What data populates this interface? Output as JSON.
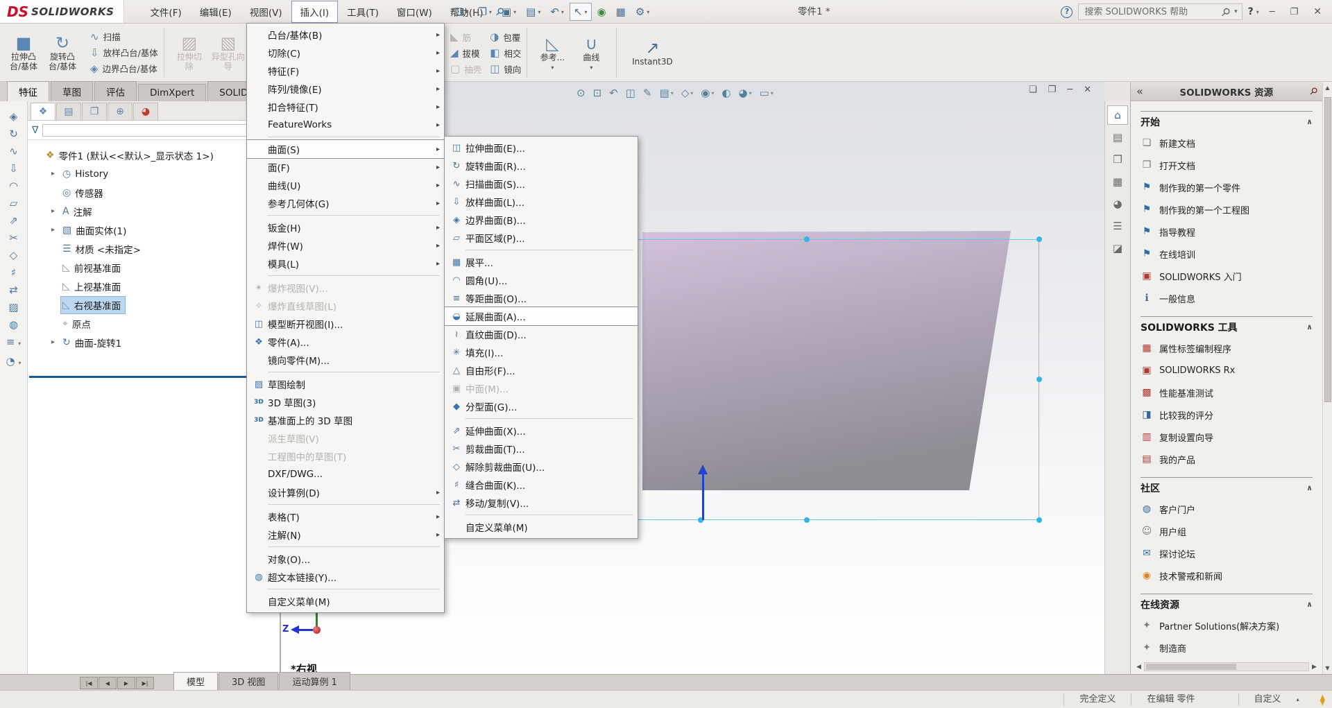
{
  "titlebar": {
    "logo_ds": "DS",
    "logo_text": "SOLIDWORKS",
    "doc_title": "零件1 *",
    "pin_icon": "⚲",
    "search": {
      "placeholder": "搜索 SOLIDWORKS 帮助",
      "help_badge": "?",
      "magnifier": "⚲",
      "caret": "▾"
    },
    "window_icons": {
      "help": "?",
      "help_caret": "▾",
      "minimize": "─",
      "restore": "❐",
      "close": "✕"
    },
    "menus": [
      {
        "label": "文件(F)"
      },
      {
        "label": "编辑(E)"
      },
      {
        "label": "视图(V)"
      },
      {
        "label": "插入(I)",
        "classes": "active"
      },
      {
        "label": "工具(T)"
      },
      {
        "label": "窗口(W)"
      },
      {
        "label": "帮助(H)"
      }
    ],
    "quickbar": [
      {
        "glyph": "❏",
        "icon_name": "new-document-icon",
        "classes": "caret"
      },
      {
        "glyph": "❐",
        "icon_name": "open-icon",
        "classes": "caret"
      },
      {
        "glyph": "▣",
        "icon_name": "save-icon",
        "classes": "caret"
      },
      {
        "glyph": "▤",
        "icon_name": "print-icon",
        "classes": "caret"
      },
      {
        "glyph": "↶",
        "icon_name": "undo-icon",
        "classes": "caret"
      },
      {
        "glyph": "↖",
        "icon_name": "select-arrow-icon",
        "classes": "caret pressed"
      },
      {
        "glyph": "◉",
        "icon_name": "rebuild-icon",
        "classes": "ic-green"
      },
      {
        "glyph": "▦",
        "icon_name": "file-properties-icon",
        "classes": ""
      },
      {
        "glyph": "⚙",
        "icon_name": "options-gear-icon",
        "classes": "caret"
      }
    ]
  },
  "ribbon": {
    "left_big": [
      {
        "label1": "拉伸凸",
        "label2": "台/基体",
        "icon": "■",
        "icon_name": "extruded-boss-icon",
        "classes": ""
      },
      {
        "label1": "旋转凸",
        "label2": "台/基体",
        "icon": "↻",
        "icon_name": "revolved-boss-icon",
        "classes": ""
      }
    ],
    "left_small": [
      {
        "label": "扫描",
        "icon": "∿",
        "icon_name": "swept-boss-icon",
        "classes": ""
      },
      {
        "label": "放样凸台/基体",
        "icon": "⇩",
        "icon_name": "lofted-boss-icon",
        "classes": ""
      },
      {
        "label": "边界凸台/基体",
        "icon": "◈",
        "icon_name": "boundary-boss-icon",
        "classes": ""
      }
    ],
    "left_big2": [
      {
        "label1": "拉伸切",
        "label2": "除",
        "icon": "▨",
        "icon_name": "extruded-cut-icon",
        "classes": "disabled"
      },
      {
        "label1": "异型孔向",
        "label2": "导",
        "icon": "▧",
        "icon_name": "hole-wizard-icon",
        "classes": "disabled"
      }
    ],
    "right_col1": [
      {
        "label": "筋",
        "icon": "◣",
        "icon_name": "rib-icon",
        "classes": "disabled"
      },
      {
        "label": "拔模",
        "icon": "◢",
        "icon_name": "draft-icon",
        "classes": ""
      },
      {
        "label": "抽壳",
        "icon": "▢",
        "icon_name": "shell-icon",
        "classes": "disabled"
      }
    ],
    "right_col2": [
      {
        "label": "包覆",
        "icon": "◑",
        "icon_name": "wrap-icon",
        "classes": ""
      },
      {
        "label": "相交",
        "icon": "◧",
        "icon_name": "intersect-icon",
        "classes": ""
      },
      {
        "label": "镜向",
        "icon": "◫",
        "icon_name": "mirror-icon",
        "classes": ""
      }
    ],
    "right_big": [
      {
        "label": "参考...",
        "icon": "◺",
        "icon_name": "reference-geometry-icon",
        "classes": "caret"
      },
      {
        "label": "曲线",
        "icon": "∪",
        "icon_name": "curves-icon",
        "classes": "caret"
      }
    ],
    "instant3d": {
      "label": "Instant3D",
      "icon": "↗",
      "icon_name": "instant3d-icon"
    },
    "tabs": [
      {
        "label": "特征",
        "classes": "active"
      },
      {
        "label": "草图",
        "classes": ""
      },
      {
        "label": "评估",
        "classes": ""
      },
      {
        "label": "DimXpert",
        "classes": ""
      },
      {
        "label": "SOLIDWORKS 插件",
        "classes": ""
      }
    ]
  },
  "left_strip": [
    {
      "glyph": "◈",
      "icon_name": "left-tool-boundary-surface-icon",
      "classes": ""
    },
    {
      "glyph": "↻",
      "icon_name": "left-tool-revolve-icon",
      "classes": ""
    },
    {
      "glyph": "∿",
      "icon_name": "left-tool-sweep-icon",
      "classes": ""
    },
    {
      "glyph": "⇩",
      "icon_name": "left-tool-loft-icon",
      "classes": ""
    },
    {
      "glyph": "◠",
      "icon_name": "left-tool-fillet-icon",
      "classes": ""
    },
    {
      "glyph": "▱",
      "icon_name": "left-tool-planar-icon",
      "classes": ""
    },
    {
      "glyph": "⇗",
      "icon_name": "left-tool-extend-icon",
      "classes": ""
    },
    {
      "glyph": "✂",
      "icon_name": "left-tool-trim-icon",
      "classes": ""
    },
    {
      "glyph": "◇",
      "icon_name": "left-tool-untrim-icon",
      "classes": ""
    },
    {
      "glyph": "♯",
      "icon_name": "left-tool-knit-icon",
      "classes": ""
    },
    {
      "glyph": "⇄",
      "icon_name": "left-tool-move-copy-icon",
      "classes": ""
    },
    {
      "glyph": "▨",
      "icon_name": "left-tool-sketch-icon",
      "classes": ""
    },
    {
      "glyph": "◍",
      "icon_name": "left-tool-fill-icon",
      "classes": ""
    },
    {
      "glyph": "≡",
      "icon_name": "left-tool-offset-icon",
      "classes": "caret"
    },
    {
      "glyph": "◔",
      "icon_name": "left-tool-freeform-icon",
      "classes": "caret"
    }
  ],
  "left_panel": {
    "tabs": [
      {
        "glyph": "❖",
        "icon_name": "featuremanager-tab-icon",
        "classes": "active"
      },
      {
        "glyph": "▤",
        "icon_name": "propertymanager-tab-icon",
        "classes": ""
      },
      {
        "glyph": "❐",
        "icon_name": "configurationmanager-tab-icon",
        "classes": ""
      },
      {
        "glyph": "⊕",
        "icon_name": "dimxpertmanager-tab-icon",
        "classes": ""
      },
      {
        "glyph": "◕",
        "icon_name": "displaymanager-tab-icon",
        "classes": "ic-multi"
      }
    ],
    "filter_icon": "∇",
    "tree": [
      {
        "label": "零件1 (默认<<默认>_显示状态 1>)",
        "icon": "❖",
        "icon_name": "part-icon",
        "classes": "root"
      },
      {
        "label": "History",
        "icon": "◷",
        "icon_name": "history-folder-icon",
        "classes": "child arrow"
      },
      {
        "label": "传感器",
        "icon": "◎",
        "icon_name": "sensors-folder-icon",
        "classes": "child"
      },
      {
        "label": "注解",
        "icon": "A",
        "icon_name": "annotations-folder-icon",
        "classes": "child arrow"
      },
      {
        "label": "曲面实体(1)",
        "icon": "▧",
        "icon_name": "surface-bodies-folder-icon",
        "classes": "child arrow"
      },
      {
        "label": "材质 <未指定>",
        "icon": "☰",
        "icon_name": "material-icon",
        "classes": "child"
      },
      {
        "label": "前视基准面",
        "icon": "◺",
        "icon_name": "front-plane-icon",
        "classes": "child ic-gray"
      },
      {
        "label": "上视基准面",
        "icon": "◺",
        "icon_name": "top-plane-icon",
        "classes": "child ic-gray"
      },
      {
        "label": "右视基准面",
        "icon": "◺",
        "icon_name": "right-plane-icon",
        "classes": "child ic-gray sel"
      },
      {
        "label": "原点",
        "icon": "⌖",
        "icon_name": "origin-icon",
        "classes": "child ic-gray"
      },
      {
        "label": "曲面-旋转1",
        "icon": "↻",
        "icon_name": "surface-revolve-feature-icon",
        "classes": "child arrow"
      }
    ]
  },
  "insert_menu": {
    "items": [
      {
        "label": "凸台/基体(B)",
        "classes": "has-sub"
      },
      {
        "label": "切除(C)",
        "classes": "has-sub"
      },
      {
        "label": "特征(F)",
        "classes": "has-sub"
      },
      {
        "label": "阵列/镜像(E)",
        "classes": "has-sub"
      },
      {
        "label": "扣合特征(T)",
        "classes": "has-sub"
      },
      {
        "label": "FeatureWorks",
        "classes": "has-sub"
      },
      {
        "label": "曲面(S)",
        "classes": "has-sub hl sep-above"
      },
      {
        "label": "面(F)",
        "classes": "has-sub"
      },
      {
        "label": "曲线(U)",
        "classes": "has-sub"
      },
      {
        "label": "参考几何体(G)",
        "classes": "has-sub"
      },
      {
        "label": "钣金(H)",
        "classes": "has-sub sep-above"
      },
      {
        "label": "焊件(W)",
        "classes": "has-sub"
      },
      {
        "label": "模具(L)",
        "classes": "has-sub"
      },
      {
        "label": "爆炸视图(V)...",
        "classes": "disabled sep-above",
        "icon": "✴",
        "icon_name": "exploded-view-icon"
      },
      {
        "label": "爆炸直线草图(L)",
        "classes": "disabled",
        "icon": "✧",
        "icon_name": "explode-line-sketch-icon"
      },
      {
        "label": "模型断开视图(I)...",
        "icon": "◫",
        "icon_name": "model-break-view-icon",
        "classes": ""
      },
      {
        "label": "零件(A)...",
        "icon": "❖",
        "icon_name": "insert-part-icon",
        "classes": ""
      },
      {
        "label": "镜向零件(M)...",
        "classes": ""
      },
      {
        "label": "草图绘制",
        "classes": "sep-above",
        "icon": "▨",
        "icon_name": "sketch-icon"
      },
      {
        "label": "3D 草图(3)",
        "icon": "3D",
        "icon_name": "3d-sketch-icon",
        "classes": "ic-txt"
      },
      {
        "label": "基准面上的 3D 草图",
        "icon": "3D",
        "icon_name": "3d-sketch-on-plane-icon",
        "classes": "ic-txt"
      },
      {
        "label": "派生草图(V)",
        "classes": "disabled"
      },
      {
        "label": "工程图中的草图(T)",
        "classes": "disabled"
      },
      {
        "label": "DXF/DWG...",
        "classes": ""
      },
      {
        "label": "设计算例(D)",
        "classes": "has-sub"
      },
      {
        "label": "表格(T)",
        "classes": "has-sub sep-above"
      },
      {
        "label": "注解(N)",
        "classes": "has-sub"
      },
      {
        "label": "对象(O)...",
        "classes": "sep-above"
      },
      {
        "label": "超文本链接(Y)...",
        "icon": "◍",
        "icon_name": "hyperlink-icon",
        "classes": ""
      },
      {
        "label": "自定义菜单(M)",
        "classes": "sep-above"
      }
    ]
  },
  "surface_menu": {
    "items": [
      {
        "label": "拉伸曲面(E)...",
        "icon": "◫",
        "icon_name": "extruded-surface-icon",
        "classes": ""
      },
      {
        "label": "旋转曲面(R)...",
        "icon": "↻",
        "icon_name": "revolved-surface-icon",
        "classes": ""
      },
      {
        "label": "扫描曲面(S)...",
        "icon": "∿",
        "icon_name": "swept-surface-icon",
        "classes": ""
      },
      {
        "label": "放样曲面(L)...",
        "icon": "⇩",
        "icon_name": "lofted-surface-icon",
        "classes": ""
      },
      {
        "label": "边界曲面(B)...",
        "icon": "◈",
        "icon_name": "boundary-surface-icon",
        "classes": ""
      },
      {
        "label": "平面区域(P)...",
        "icon": "▱",
        "icon_name": "planar-surface-icon",
        "classes": ""
      },
      {
        "label": "展平...",
        "classes": "sep-above",
        "icon": "▦",
        "icon_name": "flatten-surface-icon"
      },
      {
        "label": "圆角(U)...",
        "icon": "◠",
        "icon_name": "fillet-icon",
        "classes": ""
      },
      {
        "label": "等距曲面(O)...",
        "icon": "≡",
        "icon_name": "offset-surface-icon",
        "classes": ""
      },
      {
        "label": "延展曲面(A)...",
        "icon": "◒",
        "icon_name": "radiate-surface-icon",
        "classes": "hl"
      },
      {
        "label": "直纹曲面(D)...",
        "icon": "≀",
        "icon_name": "ruled-surface-icon",
        "classes": ""
      },
      {
        "label": "填充(I)...",
        "icon": "✳",
        "icon_name": "filled-surface-icon",
        "classes": ""
      },
      {
        "label": "自由形(F)...",
        "icon": "△",
        "icon_name": "freeform-icon",
        "classes": ""
      },
      {
        "label": "中面(M)...",
        "icon": "▣",
        "icon_name": "midsurface-icon",
        "classes": "disabled"
      },
      {
        "label": "分型面(G)...",
        "icon": "◆",
        "icon_name": "parting-surface-icon",
        "classes": ""
      },
      {
        "label": "延伸曲面(X)...",
        "classes": "sep-above",
        "icon": "⇗",
        "icon_name": "extend-surface-icon"
      },
      {
        "label": "剪裁曲面(T)...",
        "icon": "✂",
        "icon_name": "trim-surface-icon",
        "classes": ""
      },
      {
        "label": "解除剪裁曲面(U)...",
        "icon": "◇",
        "icon_name": "untrim-surface-icon",
        "classes": ""
      },
      {
        "label": "缝合曲面(K)...",
        "icon": "♯",
        "icon_name": "knit-surface-icon",
        "classes": ""
      },
      {
        "label": "移动/复制(V)...",
        "icon": "⇄",
        "icon_name": "move-copy-icon",
        "classes": ""
      },
      {
        "label": "自定义菜单(M)",
        "classes": "sep-above"
      }
    ]
  },
  "viewport": {
    "view_label": "*右视",
    "axis_z_label": "Z",
    "headsup": [
      {
        "glyph": "⊙",
        "icon_name": "zoom-to-fit-icon",
        "classes": ""
      },
      {
        "glyph": "⊡",
        "icon_name": "zoom-to-area-icon",
        "classes": ""
      },
      {
        "glyph": "↶",
        "icon_name": "previous-view-icon",
        "classes": ""
      },
      {
        "glyph": "◫",
        "icon_name": "section-view-icon",
        "classes": ""
      },
      {
        "glyph": "✎",
        "icon_name": "annotation-visibility-icon",
        "classes": ""
      },
      {
        "glyph": "▤",
        "icon_name": "view-orientation-icon",
        "classes": "caret"
      },
      {
        "glyph": "◇",
        "icon_name": "display-style-icon",
        "classes": "caret"
      },
      {
        "glyph": "◉",
        "icon_name": "hide-show-items-icon",
        "classes": "caret"
      },
      {
        "glyph": "◐",
        "icon_name": "edit-appearance-icon",
        "classes": ""
      },
      {
        "glyph": "◕",
        "icon_name": "apply-scene-icon",
        "classes": "caret"
      },
      {
        "glyph": "▭",
        "icon_name": "view-settings-icon",
        "classes": "caret"
      }
    ],
    "doc_window_icons": {
      "viewport_grid": "❏",
      "restore": "❐",
      "minimize": "─",
      "close": "✕"
    },
    "model_colors": {
      "top": "#d2c2d9",
      "mid": "#b4a8bc",
      "bottom": "#8f8c94"
    },
    "selection_color": "#35b5e5"
  },
  "task_pane": {
    "title": "SOLIDWORKS 资源",
    "back_icon": "«",
    "pin_icon": "⚲",
    "strip": [
      {
        "glyph": "⌂",
        "icon_name": "task-home-icon",
        "classes": "active"
      },
      {
        "glyph": "▤",
        "icon_name": "design-library-icon",
        "classes": ""
      },
      {
        "glyph": "❐",
        "icon_name": "file-explorer-icon",
        "classes": ""
      },
      {
        "glyph": "▦",
        "icon_name": "view-palette-icon",
        "classes": ""
      },
      {
        "glyph": "◕",
        "icon_name": "appearances-scenes-icon",
        "classes": ""
      },
      {
        "glyph": "☰",
        "icon_name": "custom-properties-icon",
        "classes": ""
      },
      {
        "glyph": "◪",
        "icon_name": "forum-tab-icon",
        "classes": ""
      }
    ],
    "rows": [
      {
        "label": "开始",
        "classes": "section"
      },
      {
        "label": "新建文档",
        "icon": "❏",
        "icon_name": "new-document-icon",
        "classes": "item ic-gray"
      },
      {
        "label": "打开文档",
        "icon": "❐",
        "icon_name": "open-document-icon",
        "classes": "item ic-gray"
      },
      {
        "label": "制作我的第一个零件",
        "icon": "⚑",
        "icon_name": "first-part-tutorial-icon",
        "classes": "item ic-blue"
      },
      {
        "label": "制作我的第一个工程图",
        "icon": "⚑",
        "icon_name": "first-drawing-tutorial-icon",
        "classes": "item ic-blue"
      },
      {
        "label": "指导教程",
        "icon": "⚑",
        "icon_name": "tutorials-icon",
        "classes": "item ic-blue"
      },
      {
        "label": "在线培训",
        "icon": "⚑",
        "icon_name": "online-training-icon",
        "classes": "item ic-blue"
      },
      {
        "label": "SOLIDWORKS 入门",
        "icon": "▣",
        "icon_name": "solidworks-intro-icon",
        "classes": "item ic-red"
      },
      {
        "label": "一般信息",
        "icon": "ℹ",
        "icon_name": "general-info-icon",
        "classes": "item ic-blue"
      },
      {
        "label": "SOLIDWORKS 工具",
        "classes": "section"
      },
      {
        "label": "属性标签编制程序",
        "icon": "▦",
        "icon_name": "property-tab-builder-icon",
        "classes": "item ic-red"
      },
      {
        "label": "SOLIDWORKS Rx",
        "icon": "▣",
        "icon_name": "solidworks-rx-icon",
        "classes": "item ic-red"
      },
      {
        "label": "性能基准测试",
        "icon": "▩",
        "icon_name": "performance-benchmark-icon",
        "classes": "item ic-red"
      },
      {
        "label": "比较我的评分",
        "icon": "◨",
        "icon_name": "compare-scores-icon",
        "classes": "item ic-blue"
      },
      {
        "label": "复制设置向导",
        "icon": "▥",
        "icon_name": "copy-settings-wizard-icon",
        "classes": "item ic-red"
      },
      {
        "label": "我的产品",
        "icon": "▤",
        "icon_name": "my-products-icon",
        "classes": "item ic-red"
      },
      {
        "label": "社区",
        "classes": "section"
      },
      {
        "label": "客户门户",
        "icon": "◍",
        "icon_name": "customer-portal-icon",
        "classes": "item ic-blue"
      },
      {
        "label": "用户组",
        "icon": "☺",
        "icon_name": "user-groups-icon",
        "classes": "item ic-gray"
      },
      {
        "label": "探讨论坛",
        "icon": "✉",
        "icon_name": "discussion-forum-icon",
        "classes": "item ic-blue"
      },
      {
        "label": "技术警戒和新闻",
        "icon": "◉",
        "icon_name": "tech-alerts-news-icon",
        "classes": "item ic-orange"
      },
      {
        "label": "在线资源",
        "classes": "section"
      },
      {
        "label": "Partner Solutions(解决方案)",
        "icon": "✦",
        "icon_name": "partner-solutions-icon",
        "classes": "item ic-gray"
      },
      {
        "label": "制造商",
        "icon": "✦",
        "icon_name": "manufacturer-icon",
        "classes": "item ic-gray"
      }
    ]
  },
  "bottom": {
    "nav": [
      {
        "glyph": "|◀",
        "icon_name": "first-sheet-icon"
      },
      {
        "glyph": "◀",
        "icon_name": "previous-sheet-icon"
      },
      {
        "glyph": "▶",
        "icon_name": "next-sheet-icon"
      },
      {
        "glyph": "▶|",
        "icon_name": "last-sheet-icon"
      }
    ],
    "tabs": [
      {
        "label": "模型",
        "classes": "active"
      },
      {
        "label": "3D 视图",
        "classes": ""
      },
      {
        "label": "运动算例 1",
        "classes": ""
      }
    ]
  },
  "statusbar": {
    "defined": "完全定义",
    "editing": "在编辑 零件",
    "custom": "自定义",
    "caret": "▴",
    "tag_icon": "⧫"
  }
}
